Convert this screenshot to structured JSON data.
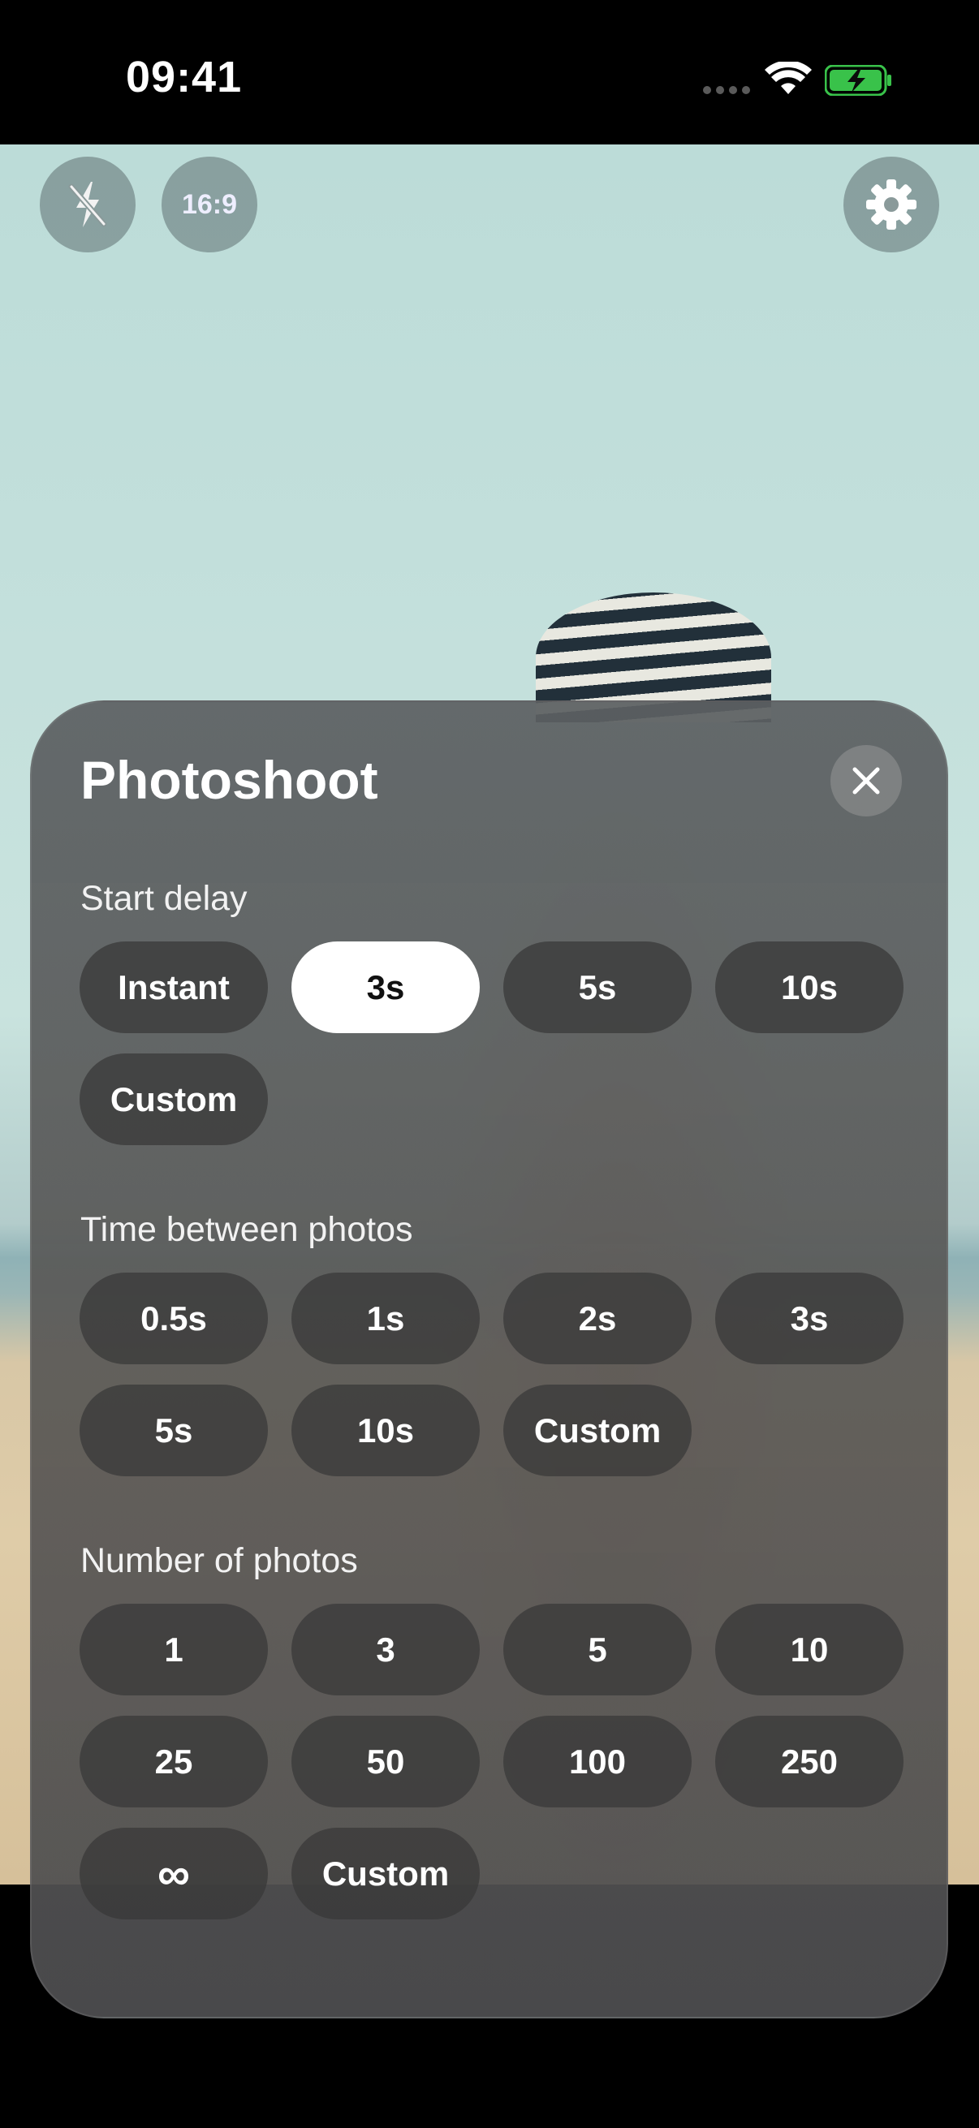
{
  "status_bar": {
    "time": "09:41"
  },
  "camera": {
    "flash_icon": "flash-off-icon",
    "aspect_ratio": "16:9",
    "settings_icon": "gear-icon"
  },
  "sheet": {
    "title": "Photoshoot",
    "close_icon": "close-icon",
    "start_delay": {
      "label": "Start delay",
      "options": [
        "Instant",
        "3s",
        "5s",
        "10s",
        "Custom"
      ],
      "selected": "3s"
    },
    "time_between": {
      "label": "Time between photos",
      "options": [
        "0.5s",
        "1s",
        "2s",
        "3s",
        "5s",
        "10s",
        "Custom"
      ]
    },
    "number_of_photos": {
      "label": "Number of photos",
      "options": [
        "1",
        "3",
        "5",
        "10",
        "25",
        "50",
        "100",
        "250",
        "∞",
        "Custom"
      ]
    }
  }
}
